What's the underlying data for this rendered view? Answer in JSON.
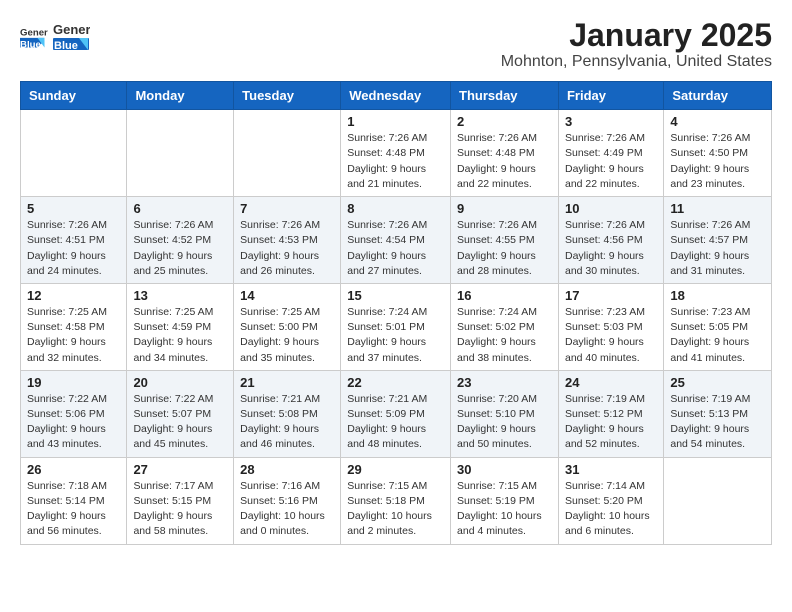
{
  "logo": {
    "general": "General",
    "blue": "Blue"
  },
  "title": "January 2025",
  "subtitle": "Mohnton, Pennsylvania, United States",
  "days_of_week": [
    "Sunday",
    "Monday",
    "Tuesday",
    "Wednesday",
    "Thursday",
    "Friday",
    "Saturday"
  ],
  "weeks": [
    [
      {
        "day": "",
        "info": ""
      },
      {
        "day": "",
        "info": ""
      },
      {
        "day": "",
        "info": ""
      },
      {
        "day": "1",
        "info": "Sunrise: 7:26 AM\nSunset: 4:48 PM\nDaylight: 9 hours\nand 21 minutes."
      },
      {
        "day": "2",
        "info": "Sunrise: 7:26 AM\nSunset: 4:48 PM\nDaylight: 9 hours\nand 22 minutes."
      },
      {
        "day": "3",
        "info": "Sunrise: 7:26 AM\nSunset: 4:49 PM\nDaylight: 9 hours\nand 22 minutes."
      },
      {
        "day": "4",
        "info": "Sunrise: 7:26 AM\nSunset: 4:50 PM\nDaylight: 9 hours\nand 23 minutes."
      }
    ],
    [
      {
        "day": "5",
        "info": "Sunrise: 7:26 AM\nSunset: 4:51 PM\nDaylight: 9 hours\nand 24 minutes."
      },
      {
        "day": "6",
        "info": "Sunrise: 7:26 AM\nSunset: 4:52 PM\nDaylight: 9 hours\nand 25 minutes."
      },
      {
        "day": "7",
        "info": "Sunrise: 7:26 AM\nSunset: 4:53 PM\nDaylight: 9 hours\nand 26 minutes."
      },
      {
        "day": "8",
        "info": "Sunrise: 7:26 AM\nSunset: 4:54 PM\nDaylight: 9 hours\nand 27 minutes."
      },
      {
        "day": "9",
        "info": "Sunrise: 7:26 AM\nSunset: 4:55 PM\nDaylight: 9 hours\nand 28 minutes."
      },
      {
        "day": "10",
        "info": "Sunrise: 7:26 AM\nSunset: 4:56 PM\nDaylight: 9 hours\nand 30 minutes."
      },
      {
        "day": "11",
        "info": "Sunrise: 7:26 AM\nSunset: 4:57 PM\nDaylight: 9 hours\nand 31 minutes."
      }
    ],
    [
      {
        "day": "12",
        "info": "Sunrise: 7:25 AM\nSunset: 4:58 PM\nDaylight: 9 hours\nand 32 minutes."
      },
      {
        "day": "13",
        "info": "Sunrise: 7:25 AM\nSunset: 4:59 PM\nDaylight: 9 hours\nand 34 minutes."
      },
      {
        "day": "14",
        "info": "Sunrise: 7:25 AM\nSunset: 5:00 PM\nDaylight: 9 hours\nand 35 minutes."
      },
      {
        "day": "15",
        "info": "Sunrise: 7:24 AM\nSunset: 5:01 PM\nDaylight: 9 hours\nand 37 minutes."
      },
      {
        "day": "16",
        "info": "Sunrise: 7:24 AM\nSunset: 5:02 PM\nDaylight: 9 hours\nand 38 minutes."
      },
      {
        "day": "17",
        "info": "Sunrise: 7:23 AM\nSunset: 5:03 PM\nDaylight: 9 hours\nand 40 minutes."
      },
      {
        "day": "18",
        "info": "Sunrise: 7:23 AM\nSunset: 5:05 PM\nDaylight: 9 hours\nand 41 minutes."
      }
    ],
    [
      {
        "day": "19",
        "info": "Sunrise: 7:22 AM\nSunset: 5:06 PM\nDaylight: 9 hours\nand 43 minutes."
      },
      {
        "day": "20",
        "info": "Sunrise: 7:22 AM\nSunset: 5:07 PM\nDaylight: 9 hours\nand 45 minutes."
      },
      {
        "day": "21",
        "info": "Sunrise: 7:21 AM\nSunset: 5:08 PM\nDaylight: 9 hours\nand 46 minutes."
      },
      {
        "day": "22",
        "info": "Sunrise: 7:21 AM\nSunset: 5:09 PM\nDaylight: 9 hours\nand 48 minutes."
      },
      {
        "day": "23",
        "info": "Sunrise: 7:20 AM\nSunset: 5:10 PM\nDaylight: 9 hours\nand 50 minutes."
      },
      {
        "day": "24",
        "info": "Sunrise: 7:19 AM\nSunset: 5:12 PM\nDaylight: 9 hours\nand 52 minutes."
      },
      {
        "day": "25",
        "info": "Sunrise: 7:19 AM\nSunset: 5:13 PM\nDaylight: 9 hours\nand 54 minutes."
      }
    ],
    [
      {
        "day": "26",
        "info": "Sunrise: 7:18 AM\nSunset: 5:14 PM\nDaylight: 9 hours\nand 56 minutes."
      },
      {
        "day": "27",
        "info": "Sunrise: 7:17 AM\nSunset: 5:15 PM\nDaylight: 9 hours\nand 58 minutes."
      },
      {
        "day": "28",
        "info": "Sunrise: 7:16 AM\nSunset: 5:16 PM\nDaylight: 10 hours\nand 0 minutes."
      },
      {
        "day": "29",
        "info": "Sunrise: 7:15 AM\nSunset: 5:18 PM\nDaylight: 10 hours\nand 2 minutes."
      },
      {
        "day": "30",
        "info": "Sunrise: 7:15 AM\nSunset: 5:19 PM\nDaylight: 10 hours\nand 4 minutes."
      },
      {
        "day": "31",
        "info": "Sunrise: 7:14 AM\nSunset: 5:20 PM\nDaylight: 10 hours\nand 6 minutes."
      },
      {
        "day": "",
        "info": ""
      }
    ]
  ]
}
